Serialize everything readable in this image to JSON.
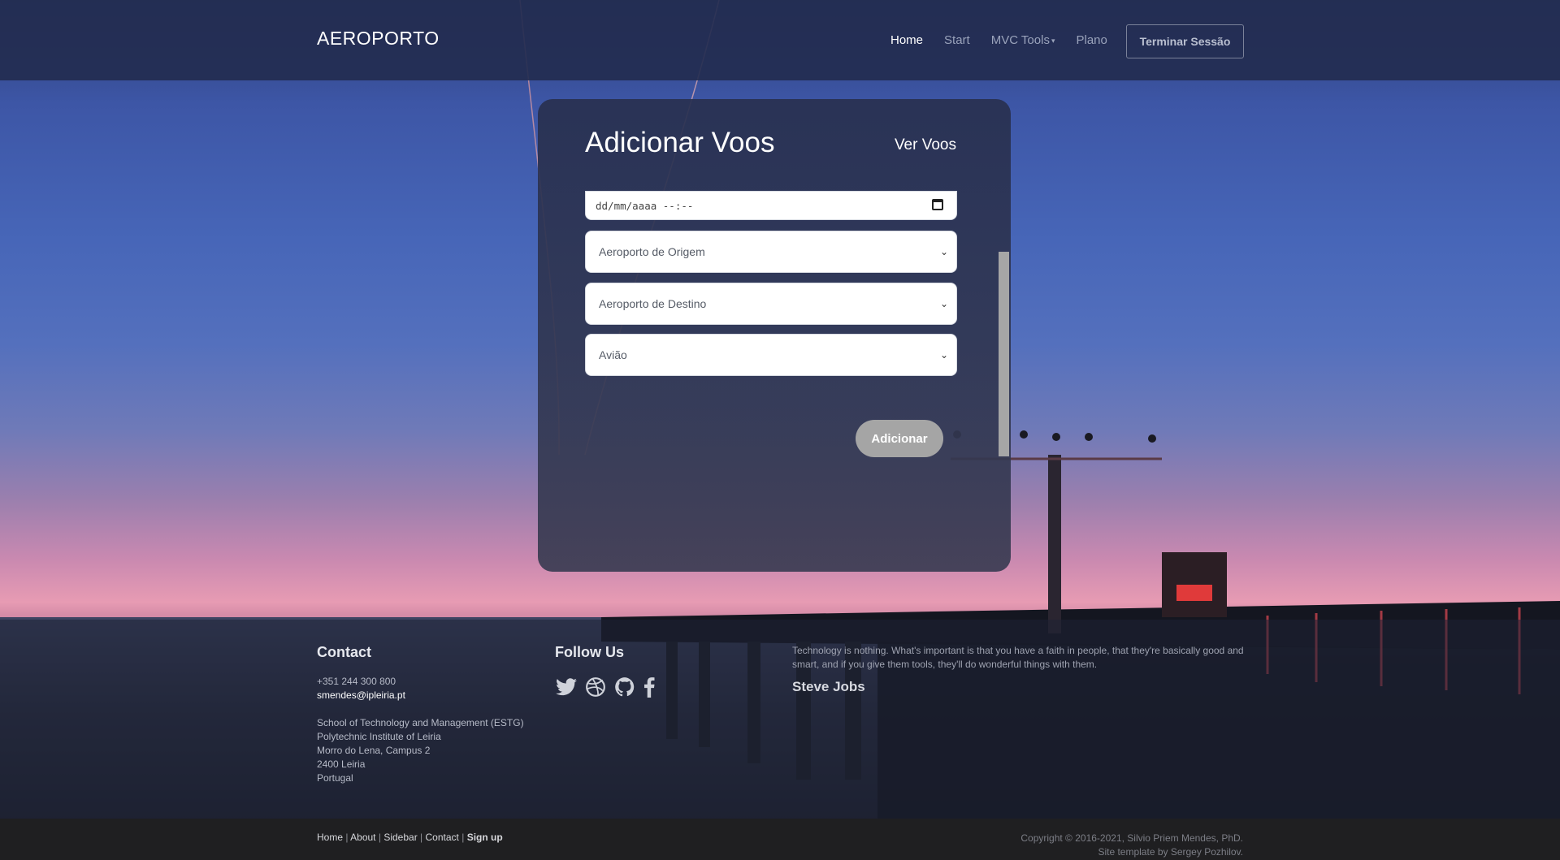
{
  "navbar": {
    "brand": "AEROPORTO",
    "links": [
      "Home",
      "Start",
      "MVC Tools",
      "Plano"
    ],
    "caret": "▾",
    "logout": "Terminar Sessão"
  },
  "form": {
    "title": "Adicionar Voos",
    "view_link": "Ver Voos",
    "date_placeholder": "dd/mm/aaaa --:--",
    "origin": "Aeroporto de Origem",
    "destination": "Aeroporto de Destino",
    "plane": "Avião",
    "submit": "Adicionar"
  },
  "footer": {
    "contact_heading": "Contact",
    "phone": "+351 244 300 800",
    "email": "smendes@ipleiria.pt",
    "address": [
      "School of Technology and Management (ESTG)",
      "Polytechnic Institute of Leiria",
      "Morro do Lena, Campus 2",
      "2400 Leiria",
      "Portugal"
    ],
    "follow_heading": "Follow Us",
    "social_icons": [
      "twitter-icon",
      "dribbble-icon",
      "github-icon",
      "facebook-icon"
    ],
    "quote": "Technology is nothing. What's important is that you have a faith in people, that they're basically good and smart, and if you give them tools, they'll do wonderful things with them.",
    "quote_author": "Steve Jobs"
  },
  "bottom": {
    "links": [
      "Home",
      "About",
      "Sidebar",
      "Contact"
    ],
    "signup": "Sign up",
    "separator": "|",
    "copyright": "Copyright © 2016-2021, Silvio Priem Mendes, PhD.",
    "template": "Site template by Sergey Pozhilov."
  }
}
